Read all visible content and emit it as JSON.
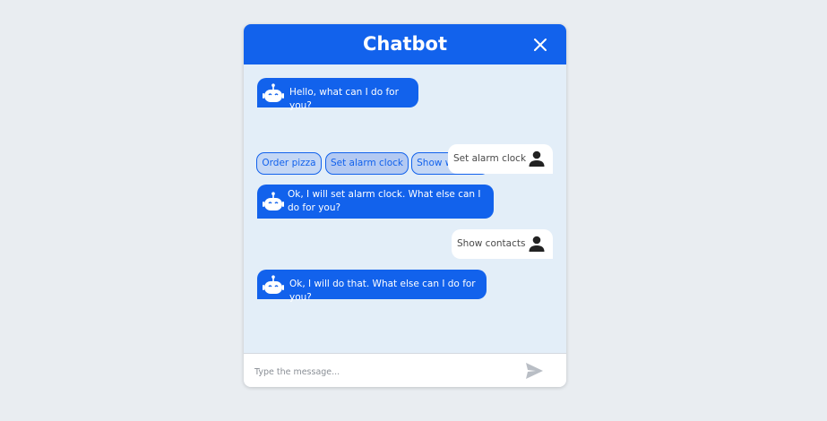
{
  "header": {
    "title": "Chatbot"
  },
  "messages": [
    {
      "from": "bot",
      "text": "Hello, what can I do for you?"
    },
    {
      "from": "user",
      "text": "Set alarm clock"
    },
    {
      "from": "bot",
      "text": "Ok, I will set alarm clock. What else can I do for you?"
    },
    {
      "from": "user",
      "text": "Show contacts"
    },
    {
      "from": "bot",
      "text": "Ok, I will do that. What else can I do for you?"
    }
  ],
  "quick_replies": [
    {
      "label": "Order pizza",
      "selected": false
    },
    {
      "label": "Set alarm clock",
      "selected": true
    },
    {
      "label": "Show weather",
      "selected": false
    }
  ],
  "composer": {
    "placeholder": "Type the message..."
  },
  "icons": {
    "close": "close-icon",
    "bot": "robot-icon",
    "user": "user-icon",
    "send": "send-icon"
  },
  "colors": {
    "primary": "#1262ec",
    "chat_background": "#e3eef8",
    "page_background": "#e9edf1",
    "user_bubble": "#ffffff"
  }
}
